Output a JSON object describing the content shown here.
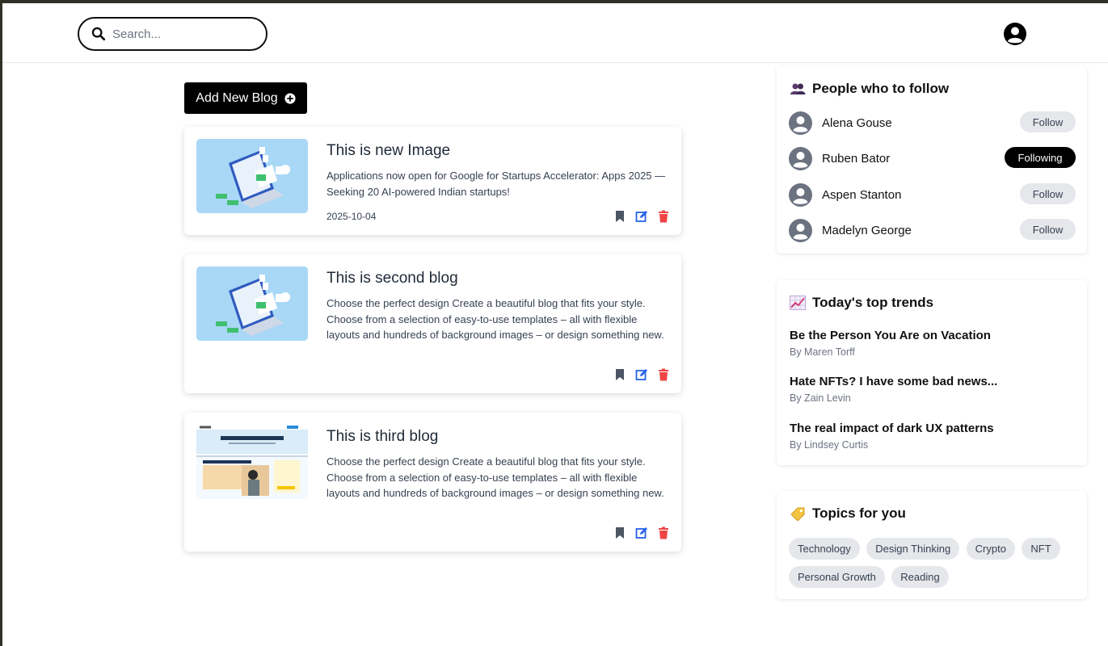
{
  "search": {
    "placeholder": "Search..."
  },
  "main": {
    "add_button_label": "Add New Blog",
    "blogs": [
      {
        "title": "This is new Image",
        "description": "Applications now open for Google for Startups Accelerator: Apps 2025 — Seeking 20 AI-powered Indian startups!",
        "date": "2025-10-04"
      },
      {
        "title": "This is second blog",
        "description": "Choose the perfect design Create a beautiful blog that fits your style. Choose from a selection of easy-to-use templates – all with flexible layouts and hundreds of background images – or design something new.",
        "date": ""
      },
      {
        "title": "This is third blog",
        "description": "Choose the perfect design Create a beautiful blog that fits your style. Choose from a selection of easy-to-use templates – all with flexible layouts and hundreds of background images – or design something new.",
        "date": ""
      }
    ]
  },
  "sidebar": {
    "follow": {
      "title": "People who to follow",
      "people": [
        {
          "name": "Alena Gouse",
          "button": "Follow"
        },
        {
          "name": "Ruben Bator",
          "button": "Following"
        },
        {
          "name": "Aspen Stanton",
          "button": "Follow"
        },
        {
          "name": "Madelyn George",
          "button": "Follow"
        }
      ]
    },
    "trends": {
      "title": "Today's top trends",
      "items": [
        {
          "title": "Be the Person You Are on Vacation",
          "author": "By Maren Torff"
        },
        {
          "title": "Hate NFTs? I have some bad news...",
          "author": "By Zain Levin"
        },
        {
          "title": "The real impact of dark UX patterns",
          "author": "By Lindsey Curtis"
        }
      ]
    },
    "topics": {
      "title": "Topics for you",
      "tags": [
        "Technology",
        "Design Thinking",
        "Crypto",
        "NFT",
        "Personal Growth",
        "Reading"
      ]
    }
  },
  "colors": {
    "delete_icon": "#ef4444",
    "edit_icon": "#2563eb",
    "bookmark_icon": "#4b5563",
    "thumbnail_bg": "#a9d8f7"
  }
}
